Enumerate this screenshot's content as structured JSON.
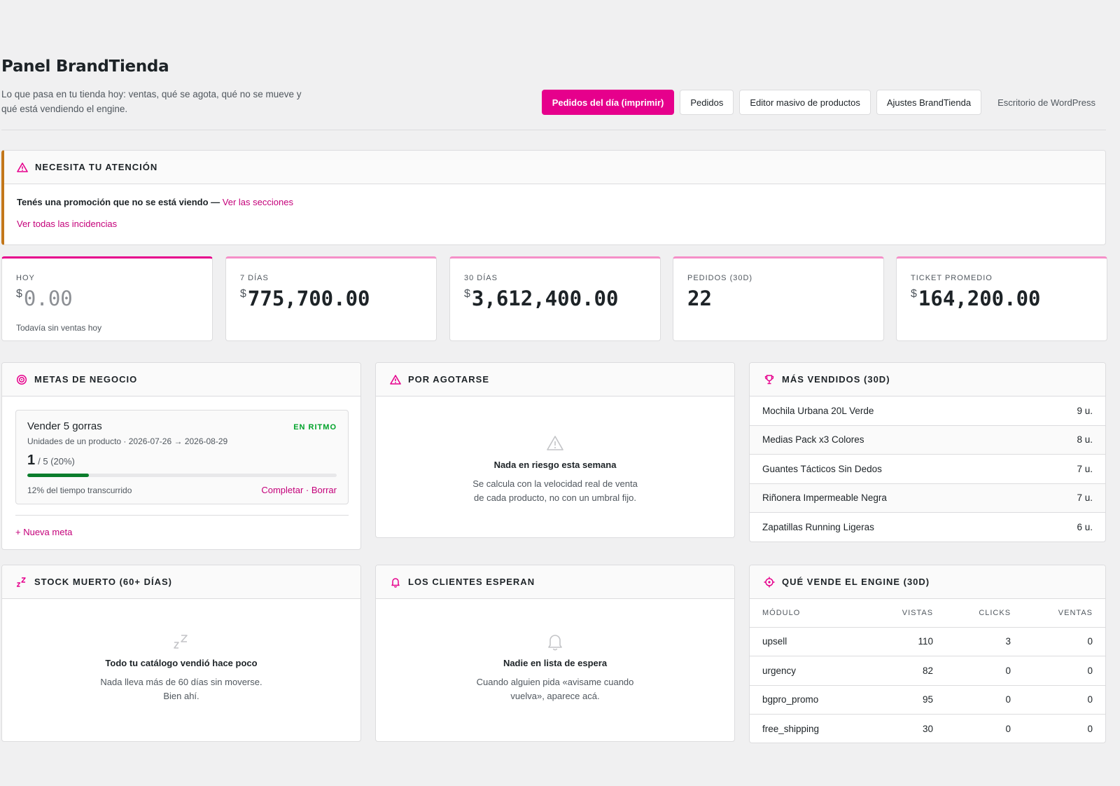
{
  "header": {
    "title": "Panel BrandTienda",
    "subtitle": "Lo que pasa en tu tienda hoy: ventas, qué se agota, qué no se mueve y qué está vendiendo el engine.",
    "buttons": {
      "orders_today": "Pedidos del día (imprimir)",
      "orders": "Pedidos",
      "bulk_editor": "Editor masivo de productos",
      "settings": "Ajustes BrandTienda",
      "wp_desktop": "Escritorio de WordPress"
    }
  },
  "attention": {
    "title": "NECESITA TU ATENCIÓN",
    "message": "Tenés una promoción que no se está viendo —",
    "message_link": "Ver las secciones",
    "view_all": "Ver todas las incidencias"
  },
  "kpis": {
    "currency": "$",
    "today": {
      "label": "HOY",
      "value": "0.00",
      "sub": "Todavía sin ventas hoy"
    },
    "days7": {
      "label": "7 DÍAS",
      "value": "775,700.00"
    },
    "days30": {
      "label": "30 DÍAS",
      "value": "3,612,400.00"
    },
    "orders30": {
      "label": "PEDIDOS (30D)",
      "value": "22"
    },
    "avg_ticket": {
      "label": "TICKET PROMEDIO",
      "value": "164,200.00"
    }
  },
  "goals": {
    "title": "METAS DE NEGOCIO",
    "item": {
      "name": "Vender 5 gorras",
      "status": "EN RITMO",
      "desc": "Unidades de un producto · 2026-07-26 → 2026-08-29",
      "current": "1",
      "target": "/ 5 (20%)",
      "progress": 0.2,
      "time": "12% del tiempo transcurrido",
      "complete": "Completar",
      "sep": " · ",
      "delete": "Borrar"
    },
    "new_goal": "+ Nueva meta"
  },
  "risk": {
    "title": "POR AGOTARSE",
    "empty_title": "Nada en riesgo esta semana",
    "empty_text": "Se calcula con la velocidad real de venta de cada producto, no con un umbral fijo."
  },
  "best_sellers": {
    "title": "MÁS VENDIDOS (30D)",
    "items": [
      {
        "name": "Mochila Urbana 20L Verde",
        "qty": "9 u."
      },
      {
        "name": "Medias Pack x3 Colores",
        "qty": "8 u."
      },
      {
        "name": "Guantes Tácticos Sin Dedos",
        "qty": "7 u."
      },
      {
        "name": "Riñonera Impermeable Negra",
        "qty": "7 u."
      },
      {
        "name": "Zapatillas Running Ligeras",
        "qty": "6 u."
      }
    ]
  },
  "dead_stock": {
    "title": "STOCK MUERTO (60+ DÍAS)",
    "empty_title": "Todo tu catálogo vendió hace poco",
    "empty_text": "Nada lleva más de 60 días sin moverse. Bien ahí."
  },
  "waiting": {
    "title": "LOS CLIENTES ESPERAN",
    "empty_title": "Nadie en lista de espera",
    "empty_text": "Cuando alguien pida «avisame cuando vuelva», aparece acá."
  },
  "engine": {
    "title": "QUÉ VENDE EL ENGINE (30D)",
    "columns": [
      "MÓDULO",
      "VISTAS",
      "CLICKS",
      "VENTAS"
    ],
    "rows": [
      [
        "upsell",
        "110",
        "3",
        "0"
      ],
      [
        "urgency",
        "82",
        "0",
        "0"
      ],
      [
        "bgpro_promo",
        "95",
        "0",
        "0"
      ],
      [
        "free_shipping",
        "30",
        "0",
        "0"
      ]
    ]
  },
  "colors": {
    "accent": "#e6008c",
    "warning": "#c3771a",
    "success": "#00a32a"
  }
}
